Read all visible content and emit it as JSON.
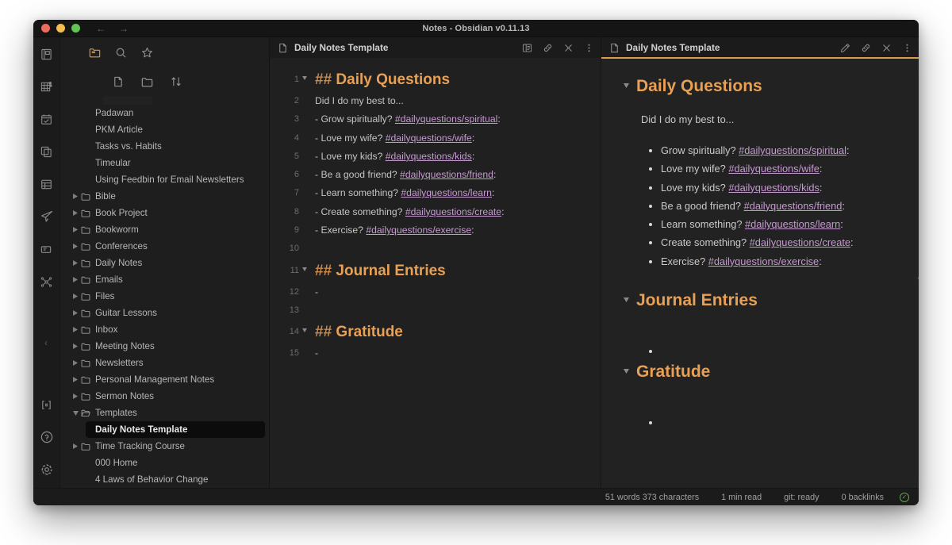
{
  "window": {
    "title": "Notes - Obsidian v0.11.13",
    "traffic_lights": [
      "close",
      "minimize",
      "maximize"
    ],
    "nav_back": "←",
    "nav_forward": "→",
    "colors": {
      "accent": "#d99b4e",
      "heading": "#e8a055",
      "tag": "#c59ad0",
      "background": "#1e1e1e",
      "status_ok": "#6f9f4f"
    }
  },
  "ribbon": {
    "items": [
      {
        "icon": "open-vault-icon",
        "label": "Open another vault"
      },
      {
        "icon": "graph-view-icon",
        "label": "Open graph view"
      },
      {
        "icon": "daily-note-icon",
        "label": "Open today's daily note"
      },
      {
        "icon": "templates-icon",
        "label": "Insert template"
      },
      {
        "icon": "calendar-grid-icon",
        "label": "Calendar"
      },
      {
        "icon": "publish-icon",
        "label": "Publish changes"
      },
      {
        "icon": "sliding-panes-icon",
        "label": "Sliding panes"
      },
      {
        "icon": "random-note-icon",
        "label": "Open random note"
      },
      {
        "icon": "command-palette-icon",
        "label": "Open command palette"
      },
      {
        "icon": "help-icon",
        "label": "Help"
      },
      {
        "icon": "settings-gear-icon",
        "label": "Settings"
      }
    ]
  },
  "explorer": {
    "toolbar": [
      {
        "icon": "folder-icon",
        "label": "Files",
        "active": true
      },
      {
        "icon": "search-icon",
        "label": "Search",
        "active": false
      },
      {
        "icon": "star-icon",
        "label": "Starred",
        "active": false
      }
    ],
    "toolbar2": [
      {
        "icon": "new-note-icon",
        "label": "New note"
      },
      {
        "icon": "new-folder-icon",
        "label": "New folder"
      },
      {
        "icon": "sort-icon",
        "label": "Change sort order"
      }
    ],
    "tree": [
      {
        "type": "file",
        "label": "Padawan",
        "indent": "file"
      },
      {
        "type": "file",
        "label": "PKM Article",
        "indent": "file"
      },
      {
        "type": "file",
        "label": "Tasks vs. Habits",
        "indent": "file"
      },
      {
        "type": "file",
        "label": "Timeular",
        "indent": "file"
      },
      {
        "type": "file",
        "label": "Using Feedbin for Email Newsletters",
        "indent": "file"
      },
      {
        "type": "folder",
        "label": "Bible",
        "expanded": false
      },
      {
        "type": "folder",
        "label": "Book Project",
        "expanded": false
      },
      {
        "type": "folder",
        "label": "Bookworm",
        "expanded": false
      },
      {
        "type": "folder",
        "label": "Conferences",
        "expanded": false
      },
      {
        "type": "folder",
        "label": "Daily Notes",
        "expanded": false
      },
      {
        "type": "folder",
        "label": "Emails",
        "expanded": false
      },
      {
        "type": "folder",
        "label": "Files",
        "expanded": false
      },
      {
        "type": "folder",
        "label": "Guitar Lessons",
        "expanded": false
      },
      {
        "type": "folder",
        "label": "Inbox",
        "expanded": false
      },
      {
        "type": "folder",
        "label": "Meeting Notes",
        "expanded": false
      },
      {
        "type": "folder",
        "label": "Newsletters",
        "expanded": false
      },
      {
        "type": "folder",
        "label": "Personal Management Notes",
        "expanded": false
      },
      {
        "type": "folder",
        "label": "Sermon Notes",
        "expanded": false
      },
      {
        "type": "folder",
        "label": "Templates",
        "expanded": true
      },
      {
        "type": "file",
        "label": "Daily Notes Template",
        "indent": "nested",
        "selected": true
      },
      {
        "type": "folder",
        "label": "Time Tracking Course",
        "expanded": false
      },
      {
        "type": "file",
        "label": "000 Home",
        "indent": "rootfile"
      },
      {
        "type": "file",
        "label": "4 Laws of Behavior Change",
        "indent": "rootfile"
      }
    ],
    "collapse_handle": "‹"
  },
  "editor_pane": {
    "title": "Daily Notes Template",
    "file_icon": "document-icon",
    "actions": [
      {
        "icon": "preview-mode-icon",
        "label": "Change view mode"
      },
      {
        "icon": "link-icon",
        "label": "Open linked view"
      },
      {
        "icon": "close-icon",
        "label": "Close pane"
      },
      {
        "icon": "more-options-icon",
        "label": "More options"
      }
    ],
    "lines": [
      {
        "n": "1",
        "fold": true,
        "type": "h2",
        "hashes": "## ",
        "text": "Daily Questions"
      },
      {
        "n": "2",
        "fold": false,
        "type": "text",
        "text": "Did I do my best to..."
      },
      {
        "n": "3",
        "fold": false,
        "type": "tagline",
        "prefix": "- Grow spiritually? ",
        "tag": "#dailyquestions/spiritual",
        "suffix": ":"
      },
      {
        "n": "4",
        "fold": false,
        "type": "tagline",
        "prefix": "- Love my wife? ",
        "tag": "#dailyquestions/wife",
        "suffix": ":"
      },
      {
        "n": "5",
        "fold": false,
        "type": "tagline",
        "prefix": "- Love my kids? ",
        "tag": "#dailyquestions/kids",
        "suffix": ":"
      },
      {
        "n": "6",
        "fold": false,
        "type": "tagline",
        "prefix": "- Be a good friend? ",
        "tag": "#dailyquestions/friend",
        "suffix": ":"
      },
      {
        "n": "7",
        "fold": false,
        "type": "tagline",
        "prefix": "- Learn something? ",
        "tag": "#dailyquestions/learn",
        "suffix": ":"
      },
      {
        "n": "8",
        "fold": false,
        "type": "tagline",
        "prefix": "- Create something? ",
        "tag": "#dailyquestions/create",
        "suffix": ":"
      },
      {
        "n": "9",
        "fold": false,
        "type": "tagline",
        "prefix": "- Exercise? ",
        "tag": "#dailyquestions/exercise",
        "suffix": ":"
      },
      {
        "n": "10",
        "fold": false,
        "type": "text",
        "text": ""
      },
      {
        "n": "11",
        "fold": true,
        "type": "h2",
        "hashes": "## ",
        "text": "Journal Entries"
      },
      {
        "n": "12",
        "fold": false,
        "type": "text",
        "text": "-"
      },
      {
        "n": "13",
        "fold": false,
        "type": "text",
        "text": ""
      },
      {
        "n": "14",
        "fold": true,
        "type": "h2",
        "hashes": "## ",
        "text": "Gratitude"
      },
      {
        "n": "15",
        "fold": false,
        "type": "text",
        "text": "-"
      }
    ]
  },
  "preview_pane": {
    "title": "Daily Notes Template",
    "file_icon": "document-icon",
    "is_active": true,
    "actions": [
      {
        "icon": "edit-pencil-icon",
        "label": "Change view mode"
      },
      {
        "icon": "link-icon",
        "label": "Open linked view"
      },
      {
        "icon": "close-icon",
        "label": "Close pane"
      },
      {
        "icon": "more-options-icon",
        "label": "More options"
      }
    ],
    "sections": [
      {
        "heading": "Daily Questions",
        "paragraph": "Did I do my best to...",
        "items": [
          {
            "prefix": "Grow spiritually? ",
            "tag": "#dailyquestions/spiritual",
            "suffix": ":"
          },
          {
            "prefix": "Love my wife? ",
            "tag": "#dailyquestions/wife",
            "suffix": ":"
          },
          {
            "prefix": "Love my kids? ",
            "tag": "#dailyquestions/kids",
            "suffix": ":"
          },
          {
            "prefix": "Be a good friend? ",
            "tag": "#dailyquestions/friend",
            "suffix": ":"
          },
          {
            "prefix": "Learn something? ",
            "tag": "#dailyquestions/learn",
            "suffix": ":"
          },
          {
            "prefix": "Create something? ",
            "tag": "#dailyquestions/create",
            "suffix": ":"
          },
          {
            "prefix": "Exercise? ",
            "tag": "#dailyquestions/exercise",
            "suffix": ":"
          }
        ]
      },
      {
        "heading": "Journal Entries",
        "paragraph": "",
        "items": [
          {
            "prefix": "",
            "tag": "",
            "suffix": ""
          }
        ]
      },
      {
        "heading": "Gratitude",
        "paragraph": "",
        "items": [
          {
            "prefix": "",
            "tag": "",
            "suffix": ""
          }
        ]
      }
    ],
    "collapse_handle": "‹"
  },
  "statusbar": {
    "items": [
      {
        "name": "word-count",
        "text": "51 words 373 characters"
      },
      {
        "name": "read-time",
        "text": "1 min read"
      },
      {
        "name": "git-status",
        "text": "git: ready"
      },
      {
        "name": "backlink-count",
        "text": "0 backlinks"
      }
    ],
    "sync_icon": "check-circle-icon",
    "sync_glyph": "✓"
  }
}
